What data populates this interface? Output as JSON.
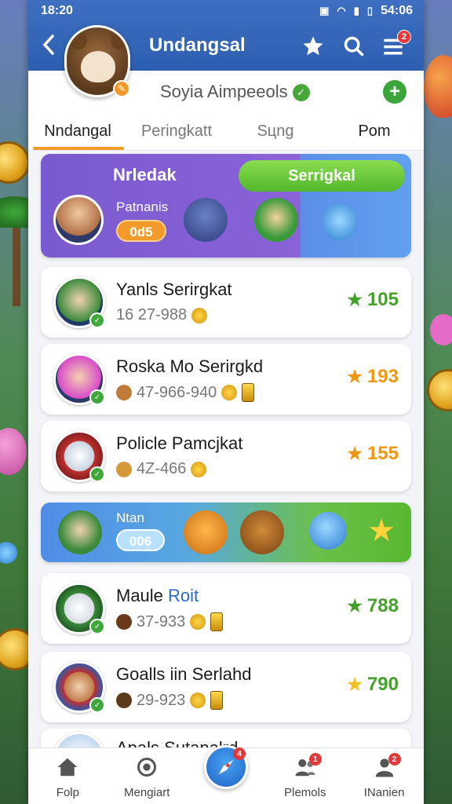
{
  "status_bar": {
    "time": "18:20",
    "battery_time": "54:06"
  },
  "header": {
    "title": "Undangsal",
    "menu_badge": "2"
  },
  "profile": {
    "name": "Soyia Aimpeeols"
  },
  "tabs": [
    {
      "label": "Nndangal"
    },
    {
      "label": "Peringkatt"
    },
    {
      "label": "Sцng"
    },
    {
      "label": "Pom"
    }
  ],
  "banner": {
    "left_label": "Nrledak",
    "pill_label": "Serrigkal",
    "sub_label": "Patnanis",
    "score": "0d5"
  },
  "entries": [
    {
      "name": "Yanls Serirgkat",
      "name_highlight": "",
      "meta": "16 27-988",
      "score": "105",
      "score_color": "green"
    },
    {
      "name": "Roska Mo Serirgkd",
      "name_highlight": "",
      "meta": "47-966-940",
      "score": "193",
      "score_color": "orange"
    },
    {
      "name": "Policle Pamcjkat",
      "name_highlight": "",
      "meta": "4Z-466",
      "score": "155",
      "score_color": "orange"
    },
    {
      "name": "Maule ",
      "name_highlight": "Roit",
      "meta": "37-933",
      "score": "788",
      "score_color": "green"
    },
    {
      "name": "Goalls iin Serlahd",
      "name_highlight": "",
      "meta": "29-923",
      "score": "790",
      "score_color": "green"
    },
    {
      "name": "Apals Sutanalrd",
      "name_highlight": "",
      "meta": "",
      "score": "",
      "score_color": "green"
    }
  ],
  "promo": {
    "label": "Ntan",
    "pill": "006"
  },
  "bottom_nav": [
    {
      "label": "Folp",
      "icon": "home-icon"
    },
    {
      "label": "Mengiart",
      "icon": "target-icon"
    },
    {
      "label": "",
      "icon": "rocket-icon",
      "badge": "4"
    },
    {
      "label": "Plemols",
      "icon": "users-icon",
      "badge": "1"
    },
    {
      "label": "INanien",
      "icon": "user-icon",
      "badge": "2"
    }
  ],
  "colors": {
    "header": "#2d5fb0",
    "accent_orange": "#f39a2a",
    "score_green": "#46a02c",
    "score_orange": "#f0960f"
  }
}
